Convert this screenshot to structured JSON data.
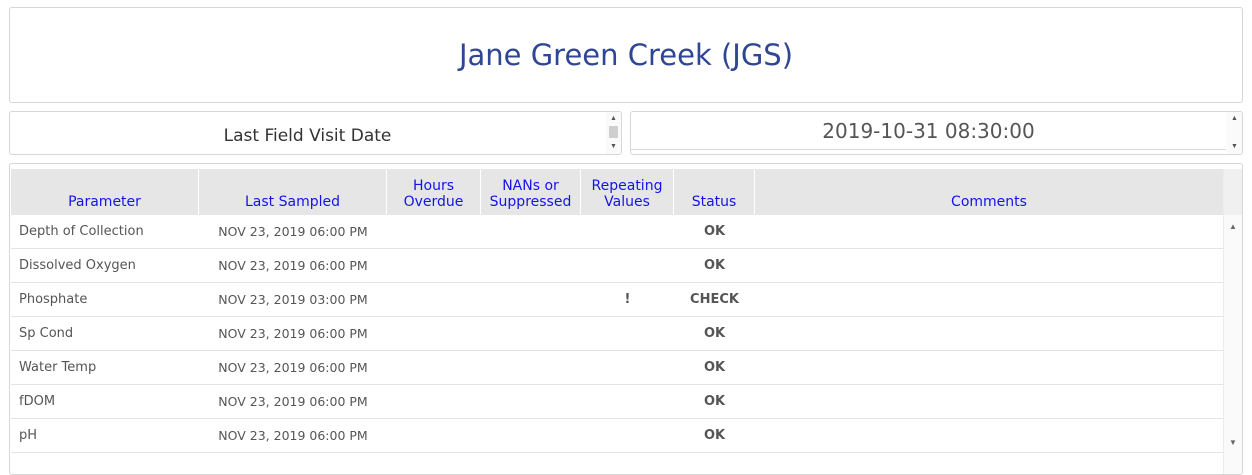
{
  "site": {
    "title": "Jane Green Creek (JGS)"
  },
  "visit": {
    "label": "Last Field Visit Date",
    "date": "2019-10-31 08:30:00"
  },
  "icons": {
    "scroll_up": "▲",
    "scroll_down": "▼"
  },
  "table": {
    "headers": {
      "parameter": "Parameter",
      "last_sampled": "Last Sampled",
      "hours_overdue": "Hours Overdue",
      "nans": "NANs or Suppressed",
      "repeating": "Repeating Values",
      "status": "Status",
      "comments": "Comments"
    },
    "rows": [
      {
        "parameter": "Depth of Collection",
        "last_sampled": "NOV 23, 2019 06:00 PM",
        "hours_overdue": "",
        "nans": "",
        "repeating": "",
        "status": "OK",
        "comments": ""
      },
      {
        "parameter": "Dissolved Oxygen",
        "last_sampled": "NOV 23, 2019 06:00 PM",
        "hours_overdue": "",
        "nans": "",
        "repeating": "",
        "status": "OK",
        "comments": ""
      },
      {
        "parameter": "Phosphate",
        "last_sampled": "NOV 23, 2019 03:00 PM",
        "hours_overdue": "",
        "nans": "",
        "repeating": "!",
        "status": "CHECK",
        "comments": ""
      },
      {
        "parameter": "Sp Cond",
        "last_sampled": "NOV 23, 2019 06:00 PM",
        "hours_overdue": "",
        "nans": "",
        "repeating": "",
        "status": "OK",
        "comments": ""
      },
      {
        "parameter": "Water Temp",
        "last_sampled": "NOV 23, 2019 06:00 PM",
        "hours_overdue": "",
        "nans": "",
        "repeating": "",
        "status": "OK",
        "comments": ""
      },
      {
        "parameter": "fDOM",
        "last_sampled": "NOV 23, 2019 06:00 PM",
        "hours_overdue": "",
        "nans": "",
        "repeating": "",
        "status": "OK",
        "comments": ""
      },
      {
        "parameter": "pH",
        "last_sampled": "NOV 23, 2019 06:00 PM",
        "hours_overdue": "",
        "nans": "",
        "repeating": "",
        "status": "OK",
        "comments": ""
      }
    ]
  }
}
